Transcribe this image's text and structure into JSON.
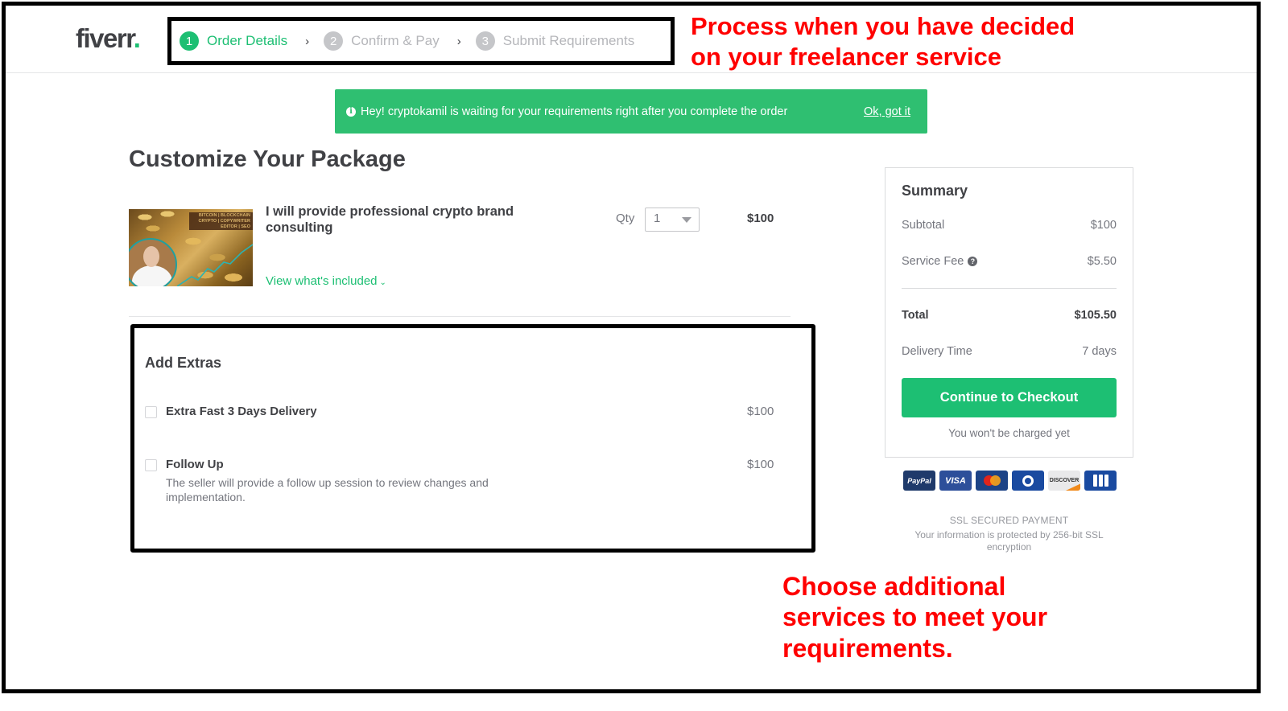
{
  "header": {
    "logo_text": "fiverr",
    "logo_dot": ".",
    "steps": [
      {
        "num": "1",
        "label": "Order Details",
        "state": "active"
      },
      {
        "num": "2",
        "label": "Confirm & Pay",
        "state": "inactive"
      },
      {
        "num": "3",
        "label": "Submit Requirements",
        "state": "inactive"
      }
    ],
    "step_separator": "›"
  },
  "annotations": {
    "top": [
      "Process when you have decided",
      "on your freelancer service"
    ],
    "bottom": [
      "Choose additional",
      "services to meet your",
      "requirements."
    ],
    "color": "#ff0000"
  },
  "banner": {
    "icon": "info-icon",
    "icon_glyph": "i",
    "message": "Hey! cryptokamil is waiting for your requirements right after you complete the order",
    "dismiss_label": "Ok, got it",
    "color": "#2fbf71"
  },
  "main": {
    "page_title": "Customize Your Package",
    "gig": {
      "image_tag_text": [
        "BITCOIN | BLOCKCHAIN",
        "CRYPTO | COPYWRITER",
        "EDITOR | SEO"
      ],
      "title": "I will provide professional crypto brand consulting",
      "view_included_label": "View what's included",
      "qty_label": "Qty",
      "qty_value": "1",
      "price": "$100"
    },
    "extras": {
      "title": "Add Extras",
      "items": [
        {
          "name": "Extra Fast 3 Days Delivery",
          "price": "$100",
          "description": "",
          "checked": false
        },
        {
          "name": "Follow Up",
          "price": "$100",
          "description": "The seller will provide a follow up session to review changes and implementation.",
          "checked": false
        }
      ]
    }
  },
  "summary": {
    "title": "Summary",
    "subtotal_label": "Subtotal",
    "subtotal_value": "$100",
    "service_fee_label": "Service Fee",
    "service_fee_value": "$5.50",
    "total_label": "Total",
    "total_value": "$105.50",
    "delivery_label": "Delivery Time",
    "delivery_value": "7 days",
    "checkout_label": "Continue to Checkout",
    "no_charge_note": "You won't be charged yet",
    "accent_color": "#1dbf73"
  },
  "payments": {
    "methods": [
      "PayPal",
      "VISA",
      "MasterCard",
      "Diners Club",
      "DISCOVER",
      "JCB"
    ],
    "ssl_title": "SSL SECURED PAYMENT",
    "ssl_text": "Your information is protected by 256-bit SSL encryption"
  }
}
